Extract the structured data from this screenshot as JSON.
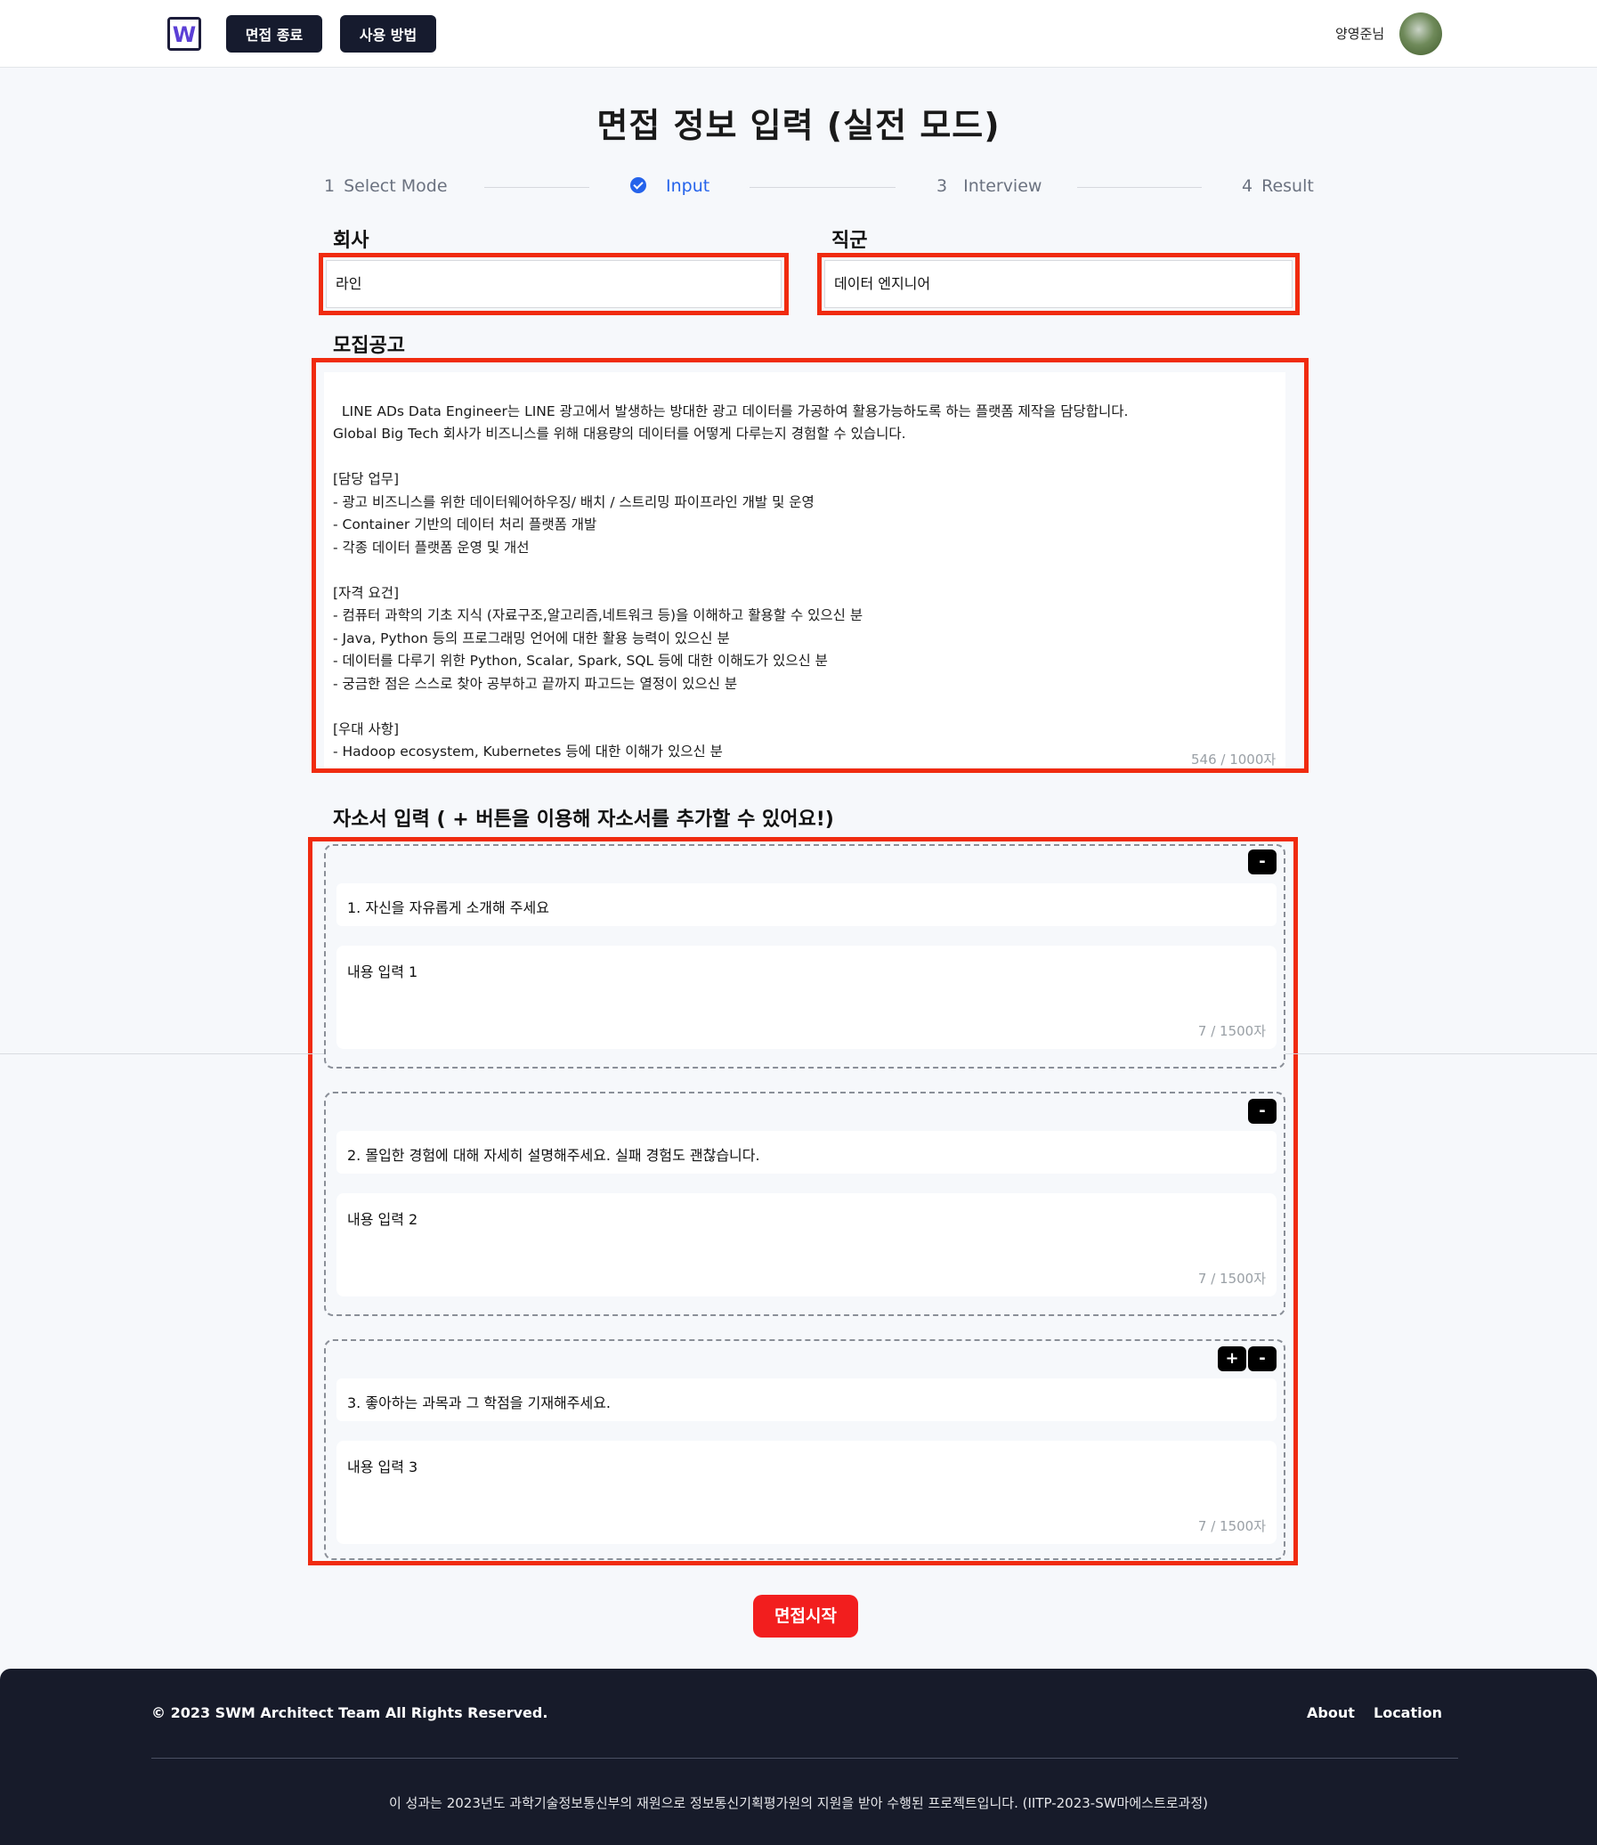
{
  "header": {
    "logo_text": "W",
    "nav": [
      {
        "label": "면접 종료"
      },
      {
        "label": "사용 방법"
      }
    ],
    "user_name": "양영준님"
  },
  "page": {
    "title": "면접 정보 입력 (실전 모드)"
  },
  "stepper": [
    {
      "num": "1",
      "label": "Select  Mode",
      "state": "done"
    },
    {
      "num": "",
      "label": "Input",
      "state": "active"
    },
    {
      "num": "3",
      "label": "Interview",
      "state": "pending"
    },
    {
      "num": "4",
      "label": "Result",
      "state": "pending"
    }
  ],
  "form": {
    "company_label": "회사",
    "company_value": "라인",
    "role_label": "직군",
    "role_value": "데이터 엔지니어",
    "posting_label": "모집공고",
    "posting_text": "LINE ADs Data Engineer는 LINE 광고에서 발생하는 방대한 광고 데이터를 가공하여 활용가능하도록 하는 플랫폼 제작을 담당합니다.\nGlobal Big Tech 회사가 비즈니스를 위해 대용량의 데이터를 어떻게 다루는지 경험할 수 있습니다.\n\n[담당 업무]\n- 광고 비즈니스를 위한 데이터웨어하우징/ 배치 / 스트리밍 파이프라인 개발 및 운영\n- Container 기반의 데이터 처리 플랫폼 개발\n- 각종 데이터 플랫폼 운영 및 개선\n\n[자격 요건]\n- 컴퓨터 과학의 기초 지식 (자료구조,알고리즘,네트워크 등)을 이해하고 활용할 수 있으신 분\n- Java, Python 등의 프로그래밍 언어에 대한 활용 능력이 있으신 분\n- 데이터를 다루기 위한 Python, Scalar, Spark, SQL 등에 대한 이해도가 있으신 분\n- 궁금한 점은 스스로 찾아 공부하고 끝까지 파고드는 열정이 있으신 분\n\n[우대 사항]\n- Hadoop ecosystem, Kubernetes 등에 대한 이해가 있으신 분\n- 데이터 처리를 위한 데이터 파이프라인에 대한 이해가 있으신 분",
    "posting_counter": "546 / 1000자",
    "cover_label": "자소서 입력 ( + 버튼을 이용해 자소서를 추가할 수 있어요!)",
    "cover_items": [
      {
        "question": "1. 자신을 자유롭게 소개해 주세요",
        "answer": "내용 입력 1",
        "counter": "7 / 1500자",
        "remove": "-"
      },
      {
        "question": "2. 몰입한 경험에 대해 자세히 설명해주세요. 실패 경험도 괜찮습니다.",
        "answer": "내용 입력 2",
        "counter": "7 / 1500자",
        "remove": "-"
      },
      {
        "question": "3. 좋아하는 과목과 그 학점을 기재해주세요.",
        "answer": "내용 입력 3",
        "counter": "7 / 1500자",
        "remove": "-",
        "add": "+"
      }
    ],
    "start_button": "면접시작"
  },
  "footer": {
    "copyright": "© 2023 SWM Architect Team All Rights Reserved.",
    "links": [
      {
        "label": "About"
      },
      {
        "label": "Location"
      }
    ],
    "note": "이 성과는 2023년도 과학기술정보통신부의 재원으로 정보통신기획평가원의 지원을 받아 수행된 프로젝트입니다. (IITP-2023-SW마에스트로과정)"
  },
  "colors": {
    "accent": "#2563eb",
    "highlight_border": "#f02b0f",
    "start_button": "#f21e1e",
    "nav_button": "#161b2e",
    "footer_bg": "#171b2a"
  }
}
